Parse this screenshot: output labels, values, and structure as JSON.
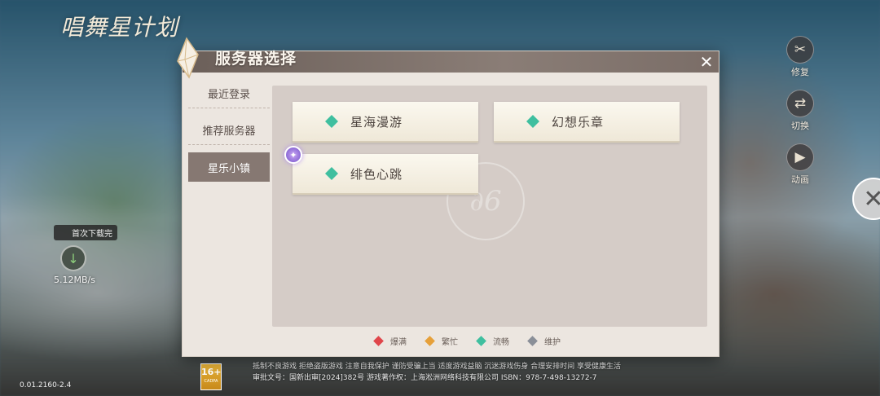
{
  "background": {
    "logo_text": "唱舞星计划"
  },
  "side_buttons": [
    {
      "label": "修复",
      "icon": "wrench-icon",
      "glyph": "✂"
    },
    {
      "label": "切换",
      "icon": "switch-account-icon",
      "glyph": "⇄"
    },
    {
      "label": "动画",
      "icon": "video-icon",
      "glyph": "▶"
    }
  ],
  "download": {
    "tip": "首次下载完",
    "speed": "5.12MB/s",
    "glyph": "↓"
  },
  "version": "0.01.2160-2.4",
  "age_rating": {
    "label": "16+",
    "sub": "CADPA"
  },
  "notice": {
    "line1": "抵制不良游戏 拒绝盗版游戏 注意自我保护 谨防受骗上当 适度游戏益脑 沉迷游戏伤身 合理安排时间 享受健康生活",
    "line2": "审批文号：国新出审[2024]382号 游戏著作权：上海淞洲网络科技有限公司 ISBN：978-7-498-13272-7"
  },
  "dialog": {
    "title": "服务器选择",
    "close_glyph": "✕",
    "tabs": [
      {
        "label": "最近登录",
        "active": false
      },
      {
        "label": "推荐服务器",
        "active": false
      },
      {
        "label": "星乐小镇",
        "active": true
      }
    ],
    "watermark": "∂6",
    "servers": [
      {
        "name": "星海漫游",
        "status_color": "#3fbf9f",
        "new": false
      },
      {
        "name": "幻想乐章",
        "status_color": "#3fbf9f",
        "new": false
      },
      {
        "name": "绯色心跳",
        "status_color": "#3fbf9f",
        "new": true
      }
    ],
    "legend": [
      {
        "label": "爆满",
        "color": "#e0454a"
      },
      {
        "label": "繁忙",
        "color": "#e6a03a"
      },
      {
        "label": "流畅",
        "color": "#3fbf9f"
      },
      {
        "label": "维护",
        "color": "#8a8f98"
      }
    ]
  }
}
